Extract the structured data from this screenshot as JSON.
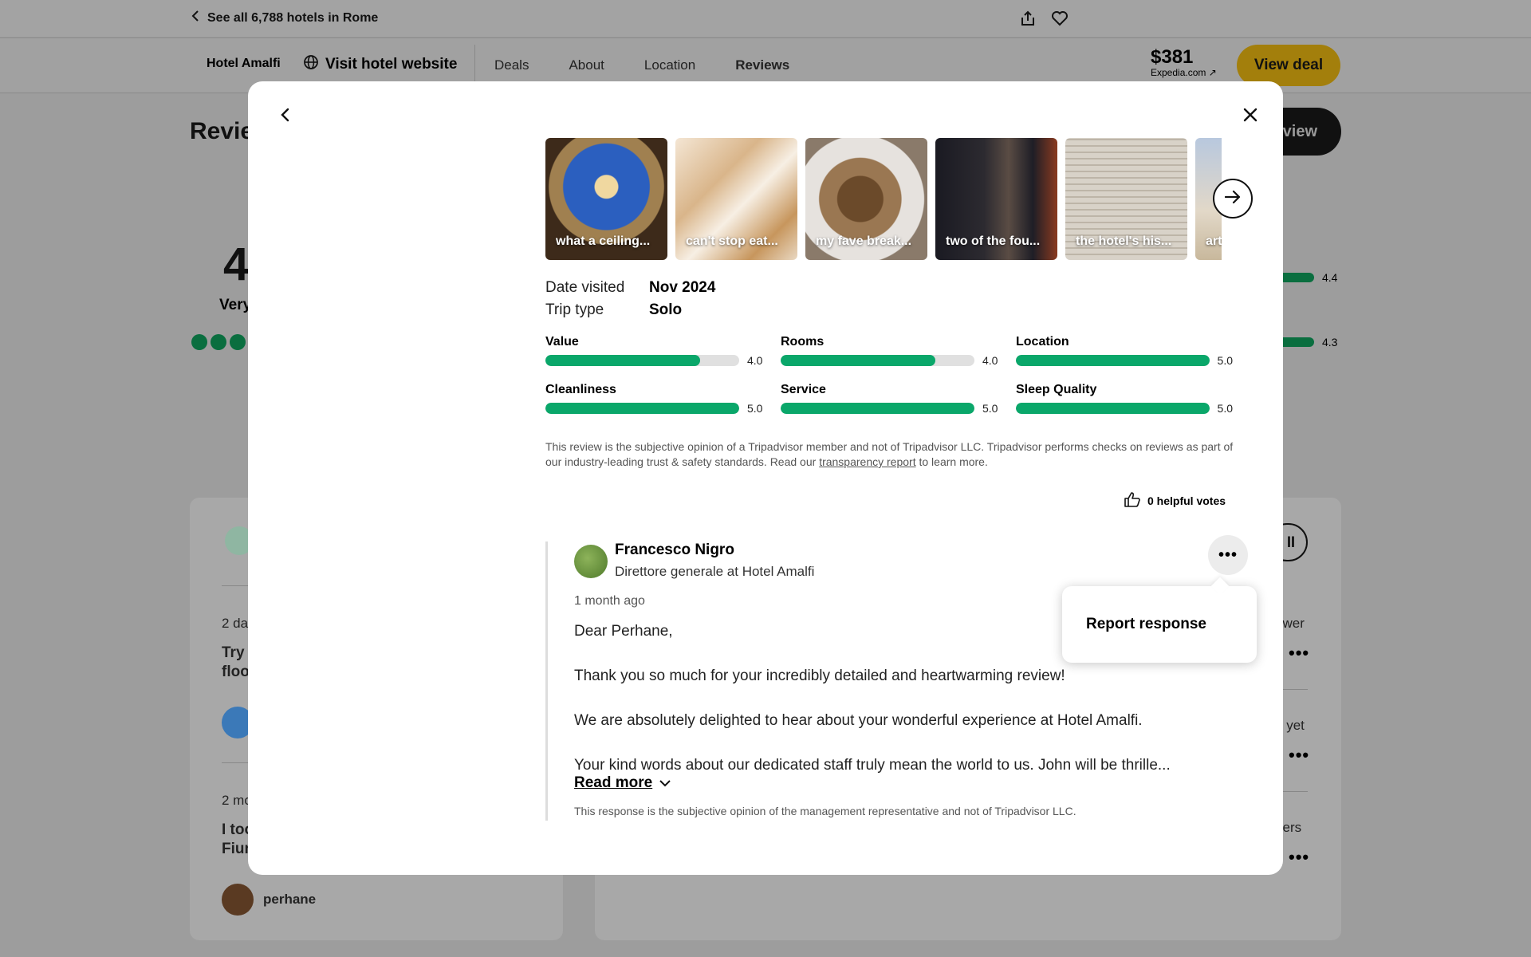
{
  "topbar": {
    "back_label": "See all 6,788 hotels in Rome"
  },
  "navbar": {
    "hotel_name": "Hotel Amalfi",
    "visit_label": "Visit hotel website",
    "tabs": [
      {
        "label": "Deals"
      },
      {
        "label": "About"
      },
      {
        "label": "Location"
      },
      {
        "label": "Reviews"
      }
    ],
    "price": "$381",
    "price_source": "Expedia.com ↗",
    "view_deal_label": "View deal"
  },
  "background": {
    "reviews_title": "Revie",
    "write_btn": "view",
    "score": "4",
    "rating_word": "Very",
    "bar_values": [
      "4.4",
      "4.3"
    ],
    "left_card": {
      "item1_time": "2 da",
      "item1_title_l1": "Try",
      "item1_title_l2": "floo",
      "item2_time": "2 mo",
      "item2_title_l1": "I too",
      "item2_title_l2": "Fium",
      "author": "perhane"
    },
    "right_card": {
      "all_btn": "ll",
      "snippets": [
        "swer",
        "s yet",
        "vers"
      ]
    }
  },
  "modal": {
    "photos": [
      {
        "caption": "what a ceiling..."
      },
      {
        "caption": "can't stop eat..."
      },
      {
        "caption": "my fave break..."
      },
      {
        "caption": "two of the fou..."
      },
      {
        "caption": "the hotel's his..."
      },
      {
        "caption": "art"
      }
    ],
    "meta": {
      "date_label": "Date visited",
      "date_value": "Nov 2024",
      "trip_label": "Trip type",
      "trip_value": "Solo"
    },
    "ratings": [
      {
        "name": "Value",
        "value": "4.0",
        "fraction": 0.8
      },
      {
        "name": "Rooms",
        "value": "4.0",
        "fraction": 0.8
      },
      {
        "name": "Location",
        "value": "5.0",
        "fraction": 1.0
      },
      {
        "name": "Cleanliness",
        "value": "5.0",
        "fraction": 1.0
      },
      {
        "name": "Service",
        "value": "5.0",
        "fraction": 1.0
      },
      {
        "name": "Sleep Quality",
        "value": "5.0",
        "fraction": 1.0
      }
    ],
    "disclaimer_pre": "This review is the subjective opinion of a Tripadvisor member and not of Tripadvisor LLC. Tripadvisor performs checks on reviews as part of our industry-leading trust & safety standards. Read our ",
    "disclaimer_link": "transparency report",
    "disclaimer_post": " to learn more.",
    "helpful_label": "0 helpful votes",
    "response": {
      "name": "Francesco Nigro",
      "role": "Direttore generale at Hotel Amalfi",
      "date": "1 month ago",
      "paragraphs": [
        "Dear Perhane,",
        "Thank you so much for your incredibly detailed and heartwarming review!",
        "We are absolutely delighted to hear about your wonderful experience at Hotel Amalfi.",
        "Your kind words about our dedicated staff truly mean the world to us. John will be thrille..."
      ],
      "read_more": "Read more",
      "disclaimer": "This response is the subjective opinion of the management representative and not of Tripadvisor LLC."
    },
    "popup": {
      "item": "Report response"
    }
  },
  "colors": {
    "accent_green": "#0aa76a",
    "deal_yellow": "#f2c00f"
  }
}
